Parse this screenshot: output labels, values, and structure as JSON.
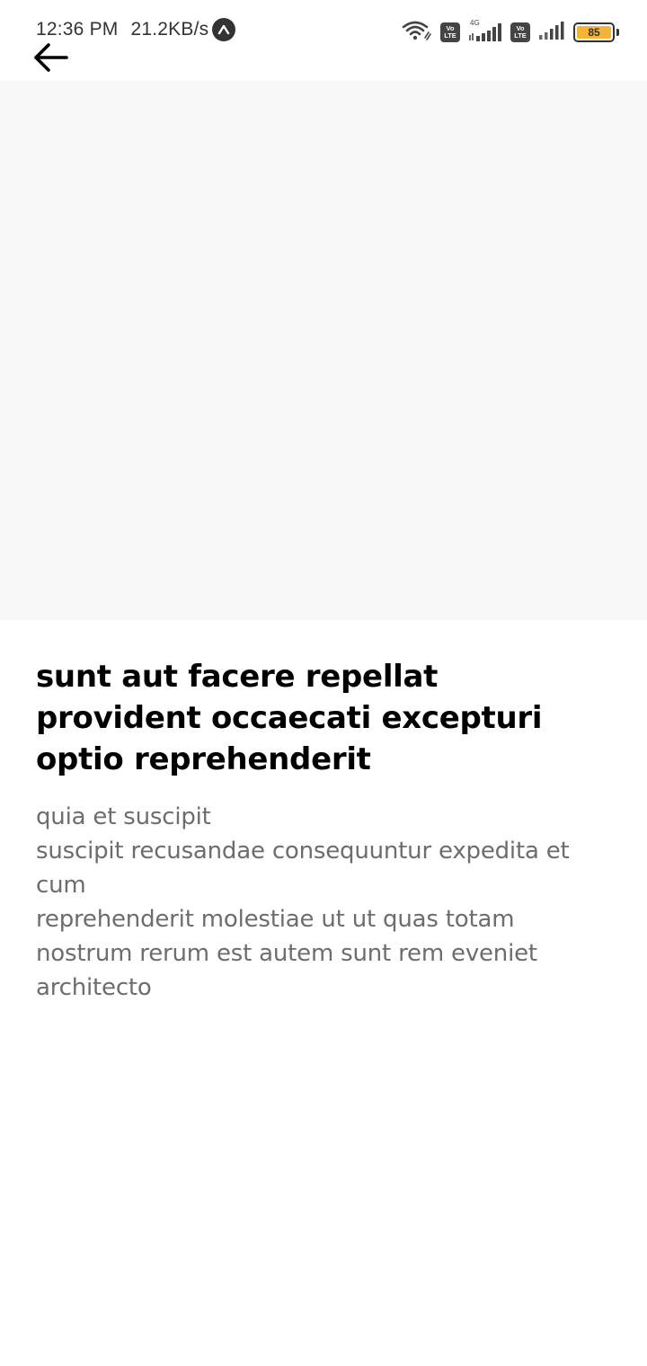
{
  "status_bar": {
    "time": "12:36 PM",
    "network_speed": "21.2KB/s",
    "volte_label_top": "Vo",
    "volte_label_bottom": "LTE",
    "network_type": "4G",
    "battery_level": "85",
    "battery_color": "#f5b435",
    "icons": [
      "wifi-icon",
      "volte-icon",
      "signal-icon",
      "volte-icon",
      "signal-icon",
      "battery-icon"
    ]
  },
  "header": {
    "back_icon": "arrow-left-icon"
  },
  "post": {
    "title": "sunt aut facere repellat provident occaecati excepturi optio reprehenderit",
    "body": "quia et suscipit\nsuscipit recusandae consequuntur expedita et cum\nreprehenderit molestiae ut ut quas totam\nnostrum rerum est autem sunt rem eveniet architecto"
  }
}
